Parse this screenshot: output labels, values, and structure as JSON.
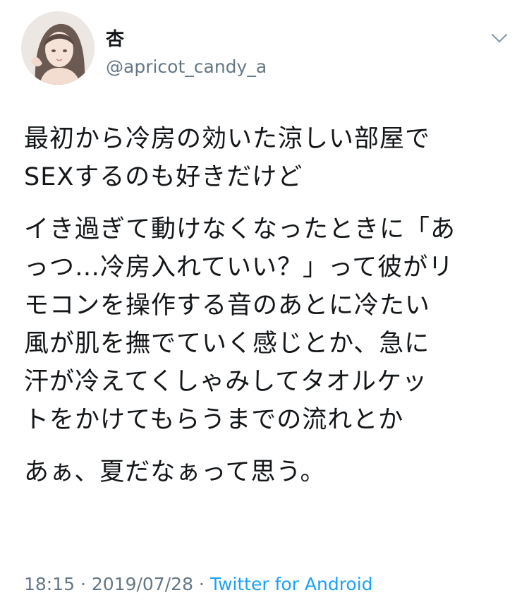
{
  "user": {
    "display_name": "杏",
    "handle": "@apricot_candy_a",
    "avatar_icon": "avatar-illustration"
  },
  "menu_icon": "chevron-down-icon",
  "tweet": {
    "paragraphs": [
      [
        "最初から冷房の効いた涼しい部屋で",
        "SEXするのも好きだけど"
      ],
      [
        "イき過ぎて動けなくなったときに「あ",
        "っつ…冷房入れていい？」って彼がリ",
        "モコンを操作する音のあとに冷たい",
        "風が肌を撫でていく感じとか、急に",
        "汗が冷えてくしゃみしてタオルケッ",
        "トをかけてもらうまでの流れとか"
      ],
      [
        "あぁ、夏だなぁって思う。"
      ]
    ]
  },
  "meta": {
    "time": "18:15 · 2019/07/28 · ",
    "source": "Twitter for Android"
  },
  "colors": {
    "text": "#14171a",
    "secondary": "#657786",
    "link": "#1da1f2"
  }
}
